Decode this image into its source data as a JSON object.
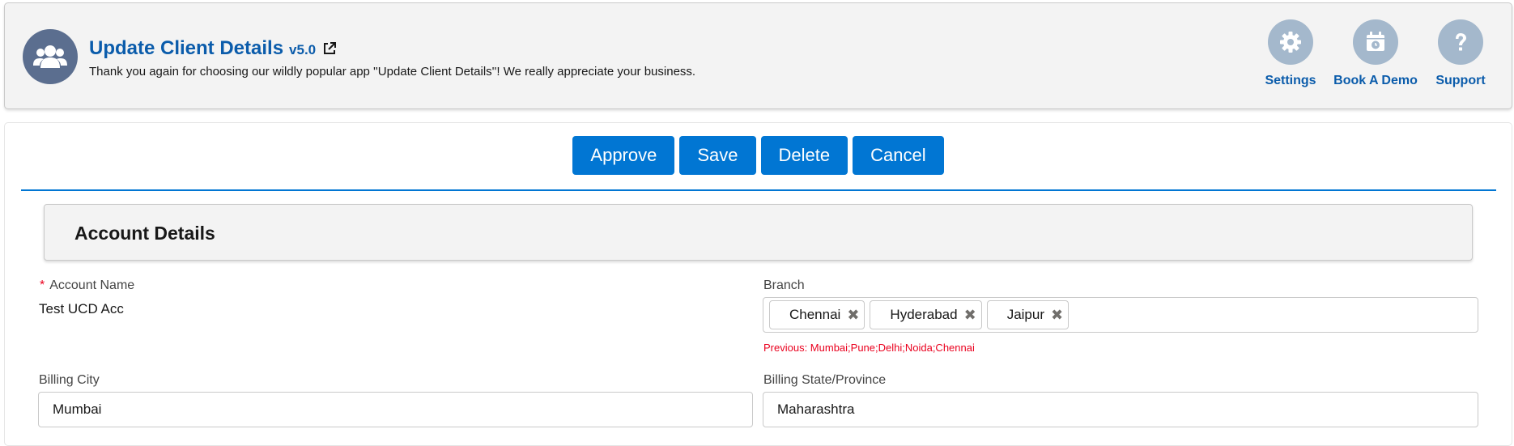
{
  "header": {
    "title": "Update Client Details",
    "version": "v5.0",
    "subtitle": "Thank you again for choosing our wildly popular app ''Update Client Details''! We really appreciate your business.",
    "avatar_icon": "group-icon",
    "actions": [
      {
        "label": "Settings",
        "icon": "gear-icon"
      },
      {
        "label": "Book A Demo",
        "icon": "calendar-icon"
      },
      {
        "label": "Support",
        "icon": "question-icon"
      }
    ]
  },
  "toolbar": {
    "approve_label": "Approve",
    "save_label": "Save",
    "delete_label": "Delete",
    "cancel_label": "Cancel"
  },
  "section": {
    "title": "Account Details"
  },
  "fields": {
    "account_name": {
      "required_mark": "*",
      "label": "Account Name",
      "value": "Test UCD Acc"
    },
    "branch": {
      "label": "Branch",
      "selected": [
        "Chennai",
        "Hyderabad",
        "Jaipur"
      ],
      "previous": "Previous: Mumbai;Pune;Delhi;Noida;Chennai"
    },
    "billing_city": {
      "label": "Billing City",
      "value": "Mumbai"
    },
    "billing_state": {
      "label": "Billing State/Province",
      "value": "Maharashtra"
    }
  },
  "colors": {
    "brand": "#0176d3",
    "title": "#0b5cab",
    "error": "#ea001e",
    "avatar": "#5b6e8f",
    "action_circle": "#a4b8cc"
  }
}
